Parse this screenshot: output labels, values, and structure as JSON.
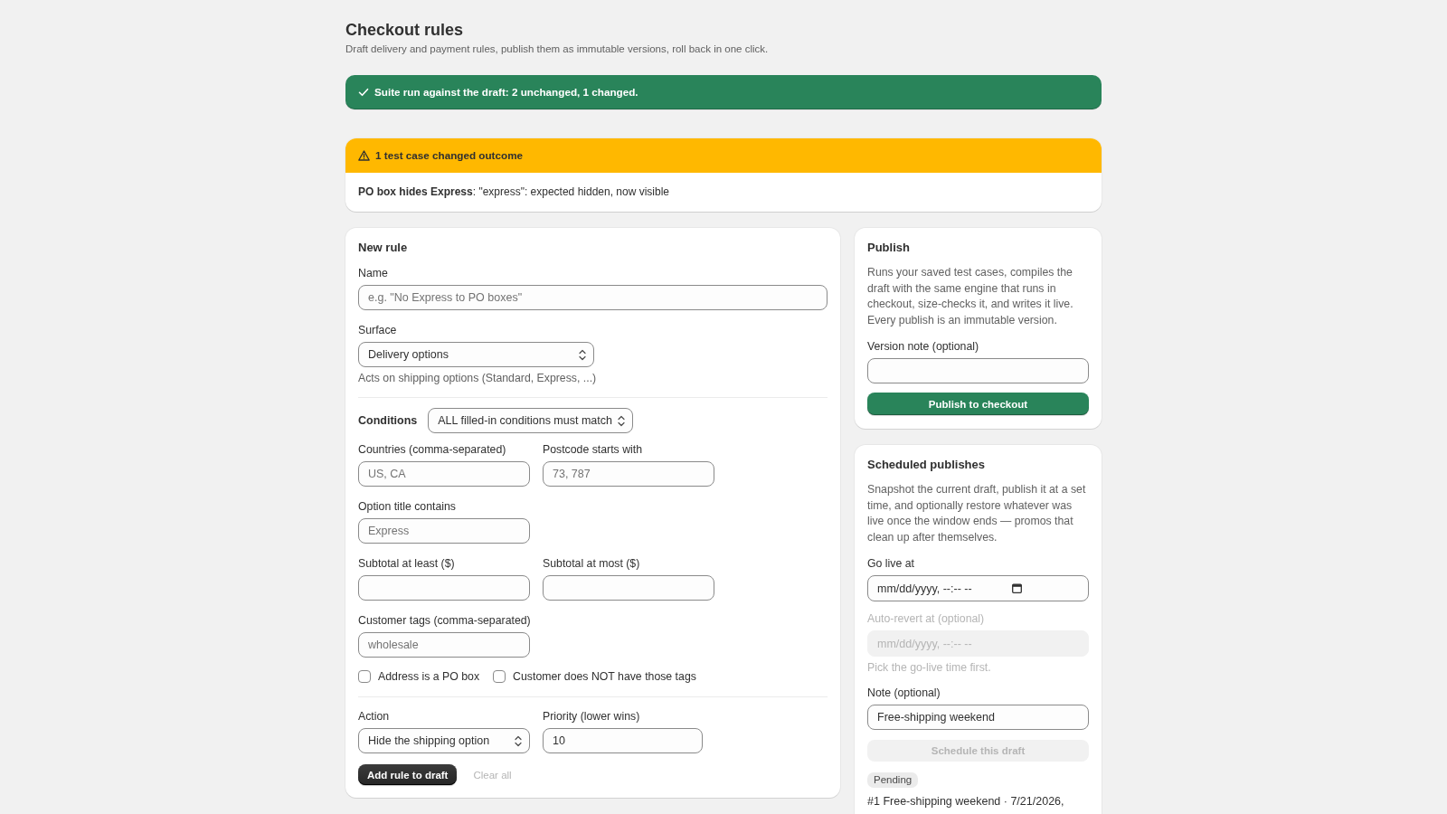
{
  "page": {
    "title": "Checkout rules",
    "subtitle": "Draft delivery and payment rules, publish them as immutable versions, roll back in one click."
  },
  "banners": [
    {
      "kind": "success",
      "title": "Suite run against the draft: 2 unchanged, 1 changed."
    },
    {
      "kind": "warning",
      "title": "1 test case changed outcome",
      "body": "**PO box hides Express**: \"express\": expected hidden, now visible"
    }
  ],
  "new_rule": {
    "title": "New rule",
    "name_field": {
      "label": "Name",
      "placeholder": "e.g. \"No Express to PO boxes\""
    },
    "surface": {
      "label": "Surface",
      "value": "Delivery options",
      "help": "Acts on shipping options (Standard, Express, ...)"
    },
    "conditions": {
      "label": "Conditions",
      "match": "ALL filled-in conditions must match",
      "rows": [
        {
          "fields": [
            {
              "label": "Countries (comma-separated)",
              "placeholder": "US, CA"
            },
            {
              "label": "Postcode starts with",
              "placeholder": "73, 787"
            }
          ]
        },
        {
          "fields": [
            {
              "label": "Option title contains",
              "placeholder": "Express"
            }
          ]
        },
        {
          "fields": [
            {
              "label": "Subtotal at least ($)"
            },
            {
              "label": "Subtotal at most ($)"
            }
          ]
        },
        {
          "fields": [
            {
              "label": "Customer tags (comma-separated)",
              "placeholder": "wholesale"
            }
          ]
        }
      ],
      "checkboxes": [
        {
          "label": "Address is a PO box",
          "checked": false
        },
        {
          "label": "Customer does NOT have those tags",
          "checked": false
        }
      ]
    },
    "action": {
      "label": "Action",
      "value": "Hide the shipping option"
    },
    "priority": {
      "label": "Priority (lower wins)",
      "value": "10"
    },
    "buttons": [
      {
        "kind": "primary",
        "label": "Add rule to draft",
        "disabled": false
      },
      {
        "kind": "plain",
        "label": "Clear all",
        "disabled": true
      }
    ]
  },
  "publish": {
    "title": "Publish",
    "description": "Runs your saved test cases, compiles the draft with the same engine that runs in checkout, size-checks it, and writes it live. Every publish is an immutable version.",
    "version_note": {
      "label": "Version note (optional)"
    },
    "button": {
      "kind": "success",
      "label": "Publish to checkout",
      "disabled": false
    }
  },
  "scheduled": {
    "title": "Scheduled publishes",
    "description": "Snapshot the current draft, publish it at a set time, and optionally restore whatever was live once the window ends — promos that clean up after themselves.",
    "go_live": {
      "label": "Go live at",
      "placeholder": "mm/dd/yyyy, --:-- --",
      "disabled": false
    },
    "auto_revert": {
      "label": "Auto-revert at (optional)",
      "placeholder": "mm/dd/yyyy, --:-- --",
      "disabled": true,
      "help": "Pick the go-live time first."
    },
    "note": {
      "label": "Note (optional)",
      "value": "Free-shipping weekend"
    },
    "button": {
      "kind": "primary",
      "label": "Schedule this draft",
      "disabled": true
    },
    "entries": [
      {
        "status": "Pending",
        "text": "#1 Free-shipping weekend · 7/21/2026,"
      }
    ]
  }
}
